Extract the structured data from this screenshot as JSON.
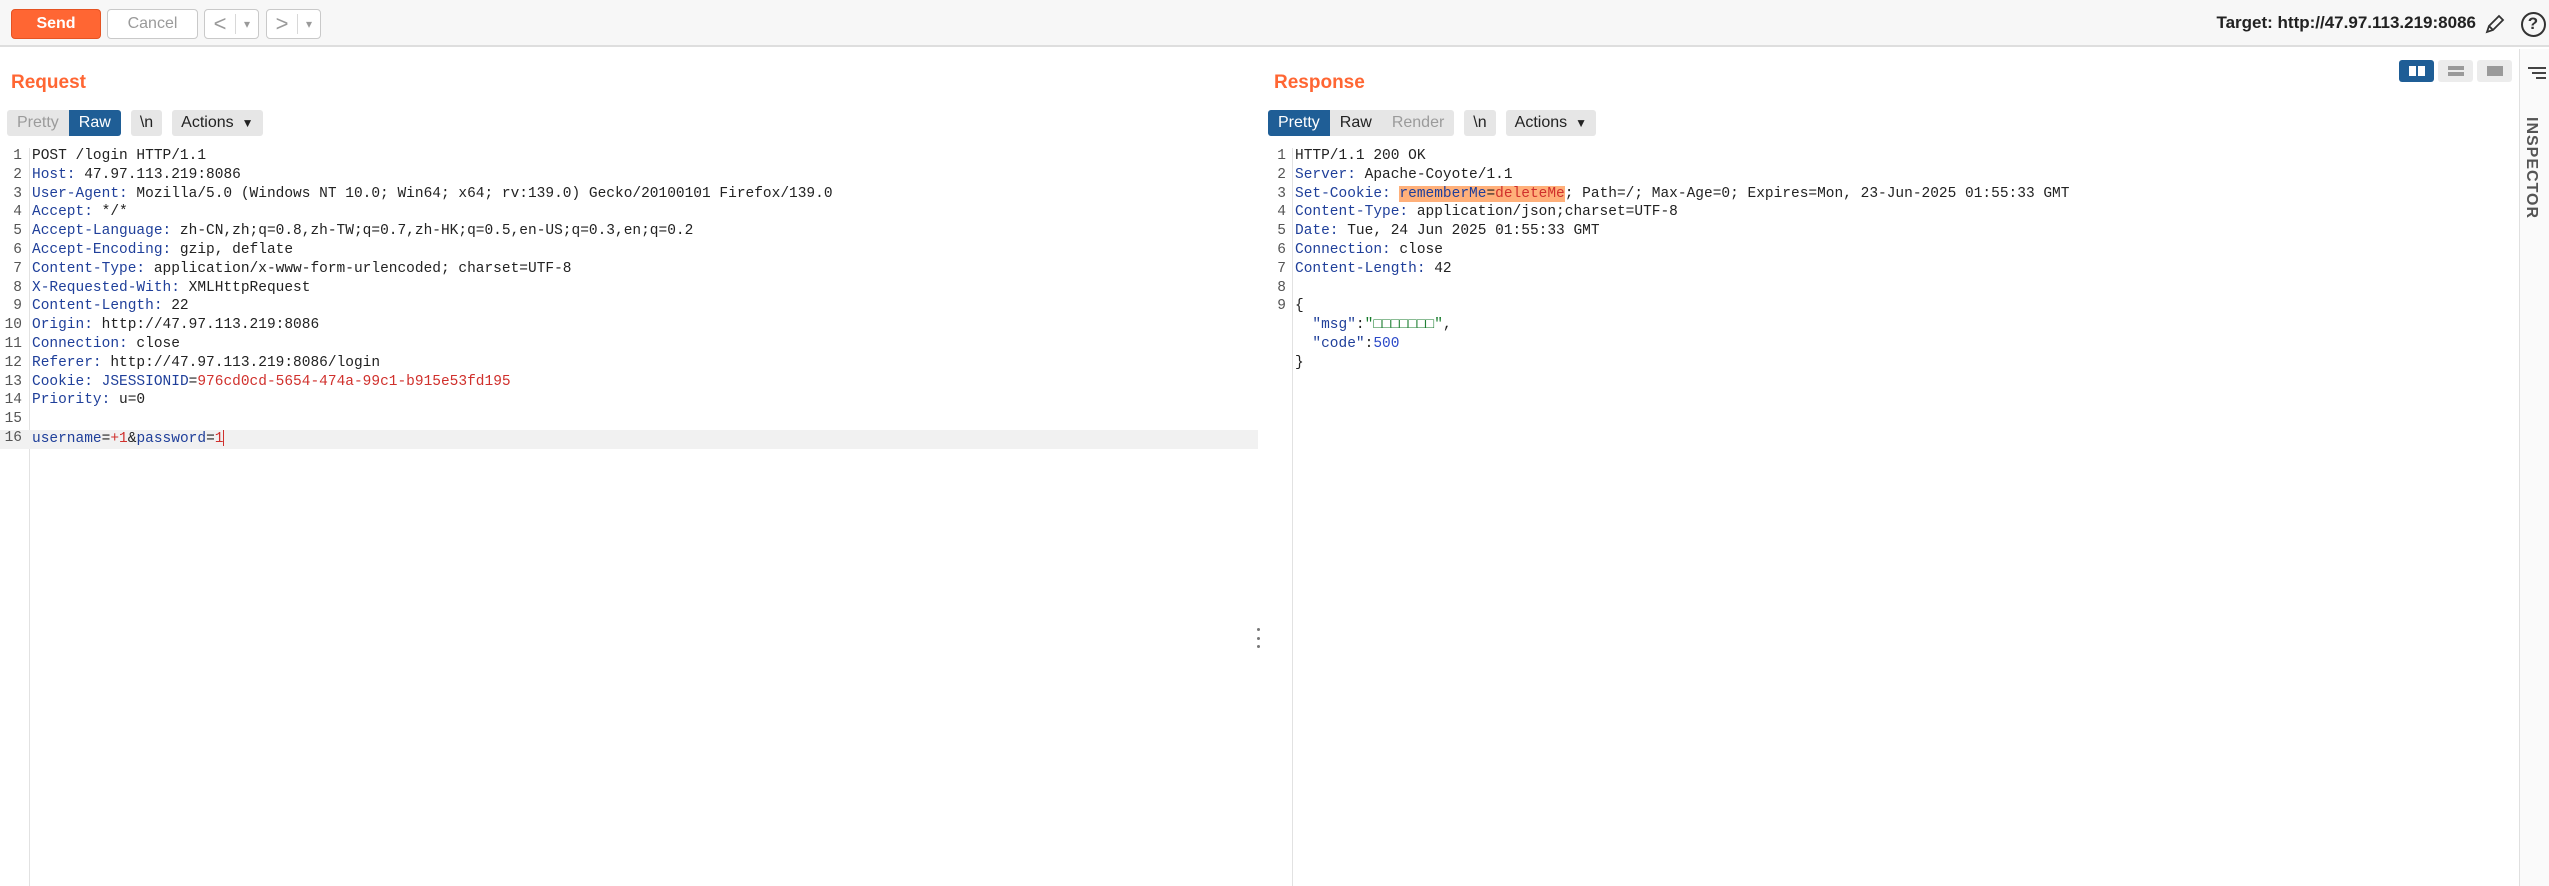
{
  "toolbar": {
    "send_label": "Send",
    "cancel_label": "Cancel",
    "back_glyph": "<",
    "forward_glyph": ">",
    "target_text": "Target: http://47.97.113.219:8086"
  },
  "request": {
    "title": "Request",
    "tabs": [
      "Pretty",
      "Raw"
    ],
    "active_tab": "Raw",
    "newline_label": "\\n",
    "actions_label": "Actions",
    "lines": [
      {
        "n": "1",
        "name": "",
        "value": "POST /login HTTP/1.1"
      },
      {
        "n": "2",
        "name": "Host:",
        "value": " 47.97.113.219:8086"
      },
      {
        "n": "3",
        "name": "User-Agent:",
        "value": " Mozilla/5.0 (Windows NT 10.0; Win64; x64; rv:139.0) Gecko/20100101 Firefox/139.0"
      },
      {
        "n": "4",
        "name": "Accept:",
        "value": " */*"
      },
      {
        "n": "5",
        "name": "Accept-Language:",
        "value": " zh-CN,zh;q=0.8,zh-TW;q=0.7,zh-HK;q=0.5,en-US;q=0.3,en;q=0.2"
      },
      {
        "n": "6",
        "name": "Accept-Encoding:",
        "value": " gzip, deflate"
      },
      {
        "n": "7",
        "name": "Content-Type:",
        "value": " application/x-www-form-urlencoded; charset=UTF-8"
      },
      {
        "n": "8",
        "name": "X-Requested-With:",
        "value": " XMLHttpRequest"
      },
      {
        "n": "9",
        "name": "Content-Length:",
        "value": " 22"
      },
      {
        "n": "10",
        "name": "Origin:",
        "value": " http://47.97.113.219:8086"
      },
      {
        "n": "11",
        "name": "Connection:",
        "value": " close"
      },
      {
        "n": "12",
        "name": "Referer:",
        "value": " http://47.97.113.219:8086/login"
      },
      {
        "n": "13",
        "name": "Cookie:",
        "value": " ",
        "cookie_name": "JSESSIONID",
        "cookie_value": "976cd0cd-5654-474a-99c1-b915e53fd195"
      },
      {
        "n": "14",
        "name": "Priority:",
        "value": " u=0"
      },
      {
        "n": "15",
        "name": "",
        "value": ""
      },
      {
        "n": "16",
        "body": true,
        "p1": "username",
        "v1": "+1",
        "p2": "password",
        "v2": "1"
      }
    ]
  },
  "response": {
    "title": "Response",
    "tabs": [
      "Pretty",
      "Raw",
      "Render"
    ],
    "active_tab": "Pretty",
    "newline_label": "\\n",
    "actions_label": "Actions",
    "lines": [
      {
        "n": "1",
        "name": "",
        "value": "HTTP/1.1 200 OK"
      },
      {
        "n": "2",
        "name": "Server:",
        "value": " Apache-Coyote/1.1"
      },
      {
        "n": "3",
        "name": "Set-Cookie:",
        "value": " ",
        "cookie_name": "rememberMe",
        "cookie_value": "deleteMe",
        "rest": "; Path=/; Max-Age=0; Expires=Mon, 23-Jun-2025 01:55:33 GMT"
      },
      {
        "n": "4",
        "name": "Content-Type:",
        "value": " application/json;charset=UTF-8"
      },
      {
        "n": "5",
        "name": "Date:",
        "value": " Tue, 24 Jun 2025 01:55:33 GMT"
      },
      {
        "n": "6",
        "name": "Connection:",
        "value": " close"
      },
      {
        "n": "7",
        "name": "Content-Length:",
        "value": " 42"
      },
      {
        "n": "8",
        "name": "",
        "value": ""
      },
      {
        "n": "9",
        "name": "",
        "value": "{"
      },
      {
        "n": "",
        "json_key": "\"msg\"",
        "json_value": "\"□□□□□□□\"",
        "json_sep": ",",
        "value_type": "string"
      },
      {
        "n": "",
        "json_key": "\"code\"",
        "json_value": "500",
        "json_sep": "",
        "value_type": "number"
      },
      {
        "n": "",
        "name": "",
        "value": "}"
      }
    ]
  },
  "sidebar": {
    "inspector_label": "INSPECTOR"
  },
  "colors": {
    "accent": "#ff6633",
    "active_tab": "#1f5e96",
    "header_name": "#1f3f9a",
    "cookie_value": "#d0302c",
    "cookie_highlight": "#ffb07a"
  }
}
